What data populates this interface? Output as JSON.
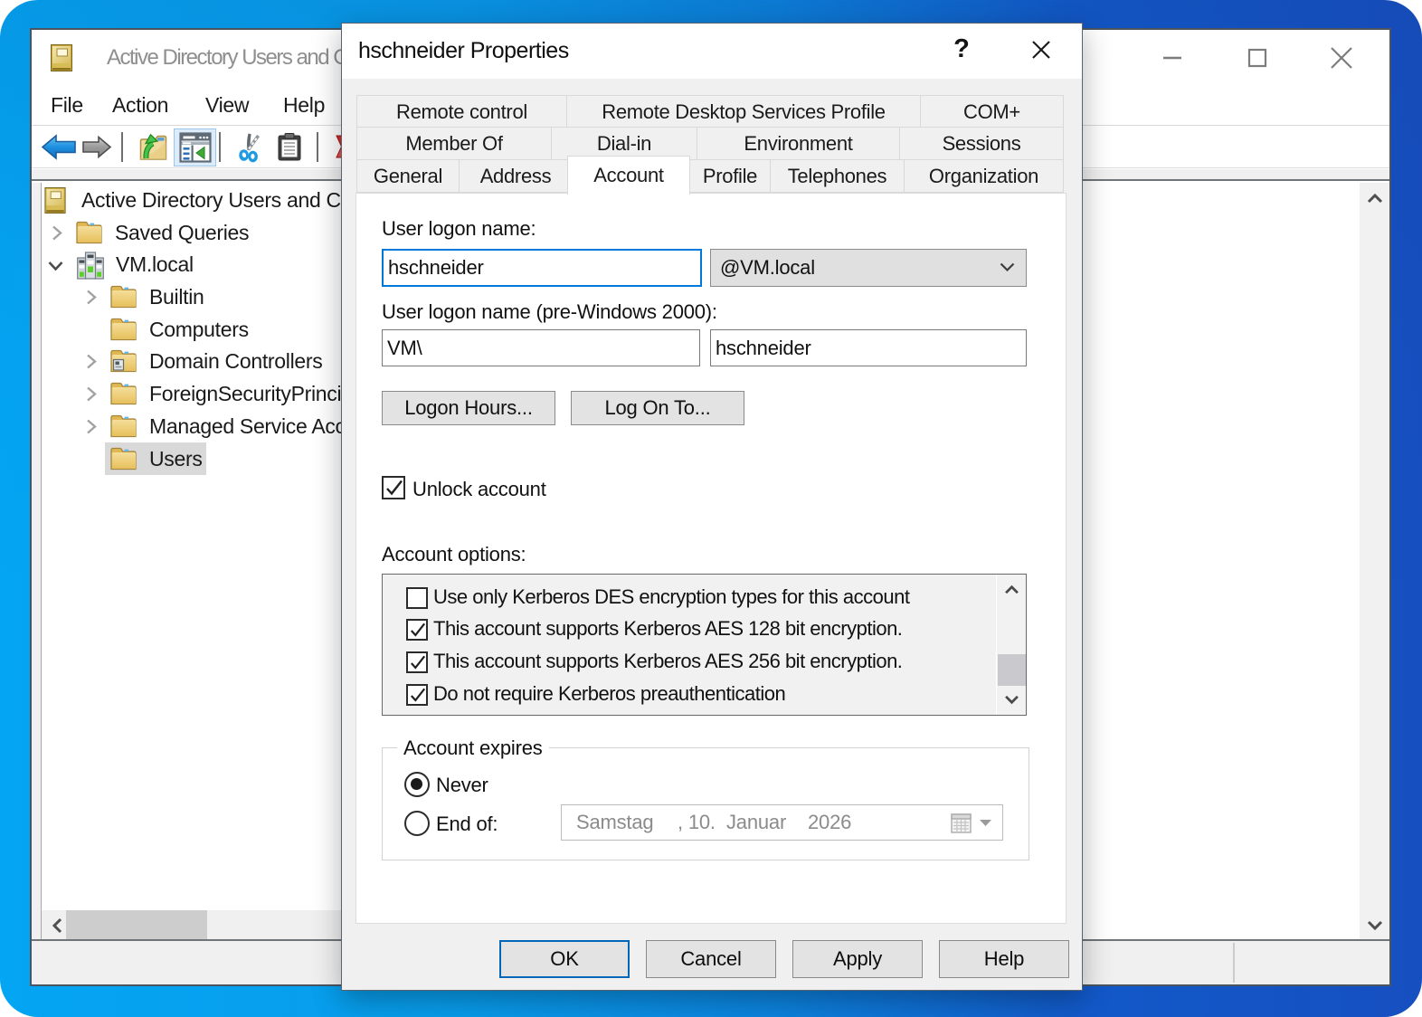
{
  "colors": {
    "desktop_left": "#0ba3f1",
    "desktop_right": "#1551c5",
    "focus_border": "#0078d7",
    "default_button_border": "#0067b8",
    "selection_gray": "#d9d9d9"
  },
  "window": {
    "title": "Active Directory Users and Computers",
    "menu": [
      "File",
      "Action",
      "View",
      "Help"
    ],
    "toolbar_icons": [
      "back",
      "forward",
      "up-folder",
      "console-tree-toggle",
      "cut",
      "paste",
      "delete"
    ],
    "tree": {
      "items": [
        {
          "label": "Active Directory Users and Computers",
          "icon": "console-book"
        },
        {
          "label": "Saved Queries",
          "icon": "folder",
          "chevron": "collapsed"
        },
        {
          "label": "VM.local",
          "icon": "domain",
          "chevron": "expanded"
        },
        {
          "label": "Builtin",
          "icon": "folder",
          "chevron": "collapsed"
        },
        {
          "label": "Computers",
          "icon": "folder"
        },
        {
          "label": "Domain Controllers",
          "icon": "folder-dc",
          "chevron": "collapsed"
        },
        {
          "label": "ForeignSecurityPrincipals",
          "icon": "folder",
          "chevron": "collapsed"
        },
        {
          "label": "Managed Service Accounts",
          "icon": "folder",
          "chevron": "collapsed"
        },
        {
          "label": "Users",
          "icon": "folder",
          "selected": true
        }
      ]
    }
  },
  "dialog": {
    "title": "hschneider Properties",
    "help_button": "?",
    "tabs": {
      "row1": [
        "Remote control",
        "Remote Desktop Services Profile",
        "COM+"
      ],
      "row2": [
        "Member Of",
        "Dial-in",
        "Environment",
        "Sessions"
      ],
      "row3": [
        "General",
        "Address",
        "Account",
        "Profile",
        "Telephones",
        "Organization"
      ],
      "active": "Account"
    },
    "account": {
      "user_logon_label": "User logon name:",
      "user_logon_value": "hschneider",
      "domain_value": "@VM.local",
      "pre2000_label": "User logon name (pre-Windows 2000):",
      "pre2000_domain": "VM\\",
      "pre2000_value": "hschneider",
      "logon_hours_button": "Logon Hours...",
      "log_on_to_button": "Log On To...",
      "unlock_label": "Unlock account",
      "unlock_checked": true,
      "options_label": "Account options:",
      "options": [
        {
          "label": "Use only Kerberos DES encryption types for this account",
          "checked": false
        },
        {
          "label": "This account supports Kerberos AES 128 bit encryption.",
          "checked": true
        },
        {
          "label": "This account supports Kerberos AES 256 bit encryption.",
          "checked": true
        },
        {
          "label": "Do not require Kerberos preauthentication",
          "checked": true
        }
      ],
      "expires_label": "Account expires",
      "expires_never": "Never",
      "expires_never_selected": true,
      "expires_end": "End of:",
      "date_day_name": "Samstag",
      "date_day": ", 10.",
      "date_month": "Januar",
      "date_year": "2026"
    },
    "buttons": [
      "OK",
      "Cancel",
      "Apply",
      "Help"
    ]
  }
}
